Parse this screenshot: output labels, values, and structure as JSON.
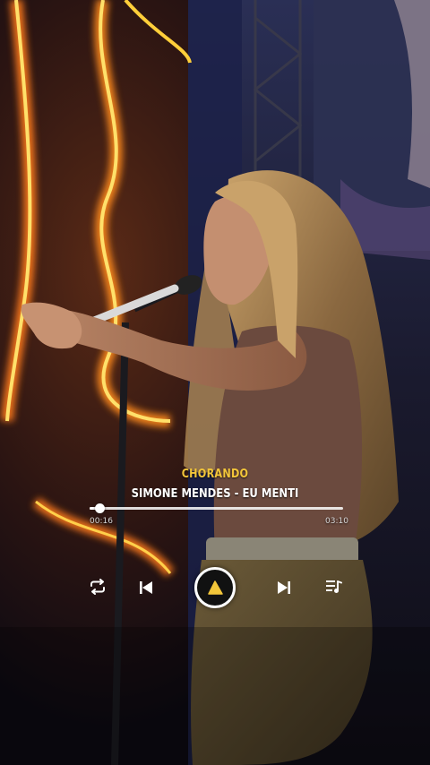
{
  "player": {
    "subtitle": "CHORANDO",
    "track_title": "SIMONE MENDES - EU MENTI",
    "time_current": "00:16",
    "time_total": "03:10",
    "progress_fraction": 0.04
  },
  "icons": {
    "repeat": "repeat-icon",
    "previous": "skip-previous-icon",
    "play": "play-icon",
    "next": "skip-next-icon",
    "queue": "playlist-icon"
  },
  "colors": {
    "accent": "#f3c63a",
    "play_button_triangle": "#f3c63a",
    "neon_orange": "#ff8c1a",
    "neon_yellow": "#ffd84a"
  }
}
